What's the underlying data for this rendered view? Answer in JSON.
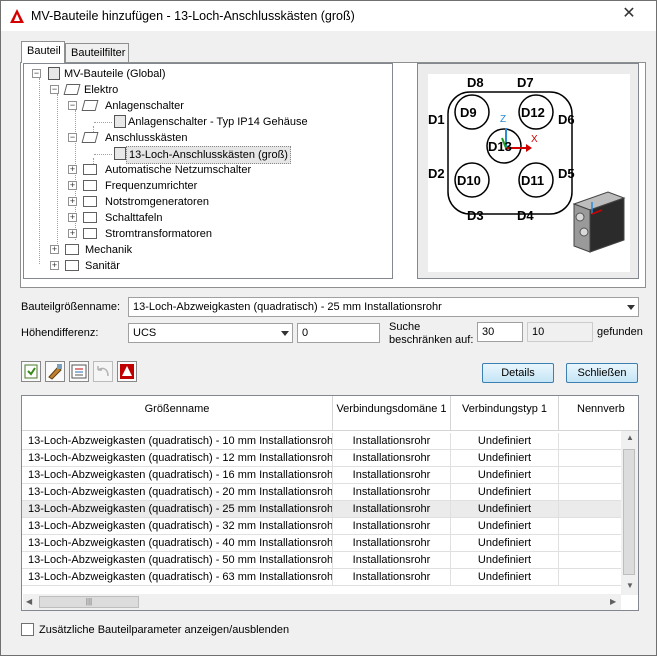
{
  "window": {
    "title": "MV-Bauteile hinzufügen - 13-Loch-Anschlusskästen (groß)"
  },
  "tabs": [
    {
      "label": "Bauteil"
    },
    {
      "label": "Bauteilfilter"
    }
  ],
  "tree": [
    {
      "label": "MV-Bauteile (Global)"
    },
    {
      "label": "Elektro"
    },
    {
      "label": "Anlagenschalter"
    },
    {
      "label": "Anlagenschalter - Typ IP14 Gehäuse"
    },
    {
      "label": "Anschlusskästen"
    },
    {
      "label": "13-Loch-Anschlusskästen (groß)"
    },
    {
      "label": "Automatische Netzumschalter"
    },
    {
      "label": "Frequenzumrichter"
    },
    {
      "label": "Notstromgeneratoren"
    },
    {
      "label": "Schalttafeln"
    },
    {
      "label": "Stromtransformatoren"
    },
    {
      "label": "Mechanik"
    },
    {
      "label": "Sanitär"
    }
  ],
  "preview": {
    "labels": [
      "D8",
      "D7",
      "D1",
      "D6",
      "D2",
      "D5",
      "D3",
      "D4",
      "D9",
      "D12",
      "D13",
      "D10",
      "D11"
    ]
  },
  "form": {
    "size_name_label": "Bauteilgrößenname:",
    "size_name_value": "13-Loch-Abzweigkasten (quadratisch) - 25 mm Installationsrohr",
    "height_label": "Höhendifferenz:",
    "height_combo": "UCS",
    "height_value": "0",
    "search_label_1": "Suche",
    "search_label_2": "beschränken auf:",
    "search_limit": "30",
    "found_count": "10",
    "found_label": "gefunden"
  },
  "buttons": {
    "details": "Details",
    "close": "Schließen"
  },
  "grid": {
    "headers": [
      "Größenname",
      "Verbindungsdomäne 1",
      "Verbindungstyp 1",
      "Nennverb"
    ],
    "rows": [
      [
        "13-Loch-Abzweigkasten (quadratisch) - 10 mm Installationsrohr",
        "Installationsrohr",
        "Undefiniert"
      ],
      [
        "13-Loch-Abzweigkasten (quadratisch) - 12 mm Installationsrohr",
        "Installationsrohr",
        "Undefiniert"
      ],
      [
        "13-Loch-Abzweigkasten (quadratisch) - 16 mm Installationsrohr",
        "Installationsrohr",
        "Undefiniert"
      ],
      [
        "13-Loch-Abzweigkasten (quadratisch) - 20 mm Installationsrohr",
        "Installationsrohr",
        "Undefiniert"
      ],
      [
        "13-Loch-Abzweigkasten (quadratisch) - 25 mm Installationsrohr",
        "Installationsrohr",
        "Undefiniert"
      ],
      [
        "13-Loch-Abzweigkasten (quadratisch) - 32 mm Installationsrohr",
        "Installationsrohr",
        "Undefiniert"
      ],
      [
        "13-Loch-Abzweigkasten (quadratisch) - 40 mm Installationsrohr",
        "Installationsrohr",
        "Undefiniert"
      ],
      [
        "13-Loch-Abzweigkasten (quadratisch) - 50 mm Installationsrohr",
        "Installationsrohr",
        "Undefiniert"
      ],
      [
        "13-Loch-Abzweigkasten (quadratisch) - 63 mm Installationsrohr",
        "Installationsrohr",
        "Undefiniert"
      ]
    ]
  },
  "footer": {
    "checkbox_label": "Zusätzliche Bauteilparameter anzeigen/ausblenden"
  },
  "colors": {
    "accent": "#cc0000",
    "selected_row": "#ebebeb",
    "button_border": "#3c7fb1"
  }
}
